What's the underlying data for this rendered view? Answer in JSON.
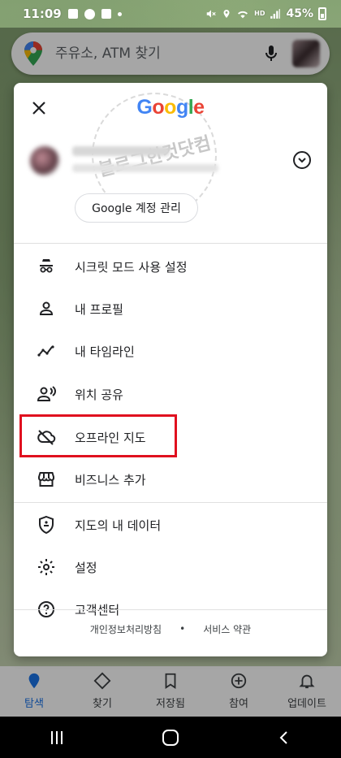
{
  "status_bar": {
    "time": "11:09",
    "battery": "45%",
    "net_label": "HD"
  },
  "search": {
    "placeholder": "주유소, ATM 찾기"
  },
  "panel": {
    "logo_text": "Google",
    "logo_colors": [
      "#4285F4",
      "#EA4335",
      "#FBBC05",
      "#4285F4",
      "#34A853",
      "#EA4335"
    ],
    "manage_account_label": "Google 계정 관리",
    "watermark_text": "블로그한컷닷컴",
    "menu_items": [
      {
        "id": "incognito",
        "icon": "incognito-icon",
        "label": "시크릿 모드 사용 설정"
      },
      {
        "id": "profile",
        "icon": "person-icon",
        "label": "내 프로필"
      },
      {
        "id": "timeline",
        "icon": "timeline-icon",
        "label": "내 타임라인"
      },
      {
        "id": "location-sharing",
        "icon": "location-sharing-icon",
        "label": "위치 공유"
      },
      {
        "id": "offline-maps",
        "icon": "cloud-off-icon",
        "label": "오프라인 지도"
      },
      {
        "id": "add-business",
        "icon": "storefront-icon",
        "label": "비즈니스 추가"
      },
      {
        "id": "your-data",
        "icon": "shield-icon",
        "label": "지도의 내 데이터"
      },
      {
        "id": "settings",
        "icon": "gear-icon",
        "label": "설정"
      },
      {
        "id": "help",
        "icon": "help-icon",
        "label": "고객센터"
      }
    ],
    "footer": {
      "privacy_label": "개인정보처리방침",
      "separator": "•",
      "terms_label": "서비스 약관"
    },
    "highlight_color": "#e0101f"
  },
  "bottom_nav": [
    {
      "id": "explore",
      "icon": "location-pin-icon",
      "label": "탐색",
      "active": true
    },
    {
      "id": "go",
      "icon": "directions-icon",
      "label": "찾기",
      "active": false
    },
    {
      "id": "saved",
      "icon": "bookmark-icon",
      "label": "저장됨",
      "active": false
    },
    {
      "id": "contribute",
      "icon": "add-circle-icon",
      "label": "참여",
      "active": false
    },
    {
      "id": "updates",
      "icon": "bell-icon",
      "label": "업데이트",
      "active": false
    }
  ],
  "accent_color": "#1a73e8"
}
